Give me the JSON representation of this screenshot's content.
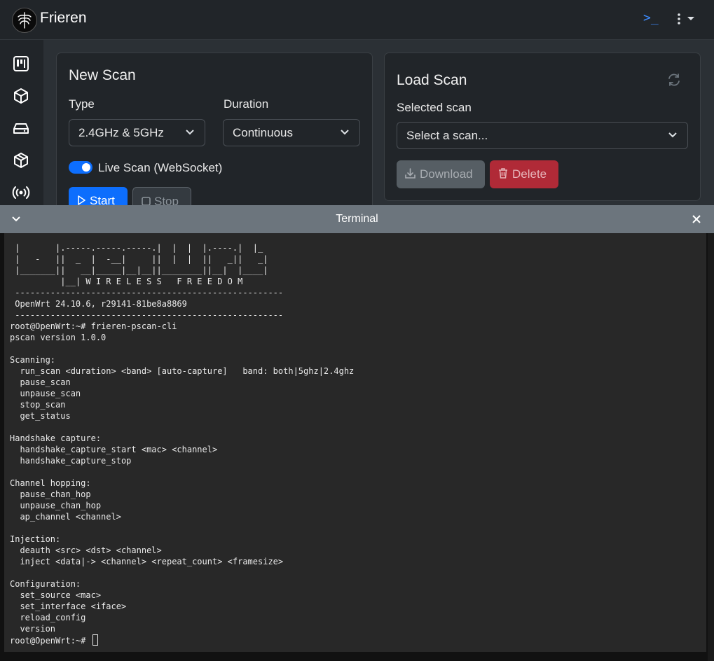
{
  "app": {
    "name": "Frieren"
  },
  "navbar": {
    "terminal_icon_label": ">_"
  },
  "sidebar": {
    "items": [
      {
        "icon": "kanban-board-icon"
      },
      {
        "icon": "box-icon"
      },
      {
        "icon": "router-drive-icon"
      },
      {
        "icon": "box-seam-icon"
      },
      {
        "icon": "broadcast-icon"
      }
    ]
  },
  "new_scan": {
    "title": "New Scan",
    "type_label": "Type",
    "type_value": "2.4GHz & 5GHz",
    "duration_label": "Duration",
    "duration_value": "Continuous",
    "live_scan_label": "Live Scan (WebSocket)",
    "live_scan_on": true,
    "start_label": "Start",
    "stop_label": "Stop"
  },
  "load_scan": {
    "title": "Load Scan",
    "selected_label": "Selected scan",
    "select_placeholder": "Select a scan...",
    "download_label": "Download",
    "delete_label": "Delete"
  },
  "terminal": {
    "title": "Terminal",
    "lines": [
      " |       |.-----.-----.-----.|  |  |  |.----.|  |_",
      " |   -   ||  _  |  -__|     ||  |  |  ||   _||   _|",
      " |_______||   __|_____|__|__||________||__|  |____|",
      "          |__| W I R E L E S S   F R E E D O M",
      " -----------------------------------------------------",
      " OpenWrt 24.10.6, r29141-81be8a8869",
      " -----------------------------------------------------",
      "root@OpenWrt:~# frieren-pscan-cli",
      "pscan version 1.0.0",
      "",
      "Scanning:",
      "  run_scan <duration> <band> [auto-capture]   band: both|5ghz|2.4ghz",
      "  pause_scan",
      "  unpause_scan",
      "  stop_scan",
      "  get_status",
      "",
      "Handshake capture:",
      "  handshake_capture_start <mac> <channel>",
      "  handshake_capture_stop",
      "",
      "Channel hopping:",
      "  pause_chan_hop",
      "  unpause_chan_hop",
      "  ap_channel <channel>",
      "",
      "Injection:",
      "  deauth <src> <dst> <channel>",
      "  inject <data|-> <channel> <repeat_count> <framesize>",
      "",
      "Configuration:",
      "  set_source <mac>",
      "  set_interface <iface>",
      "  reload_config",
      "  version"
    ],
    "prompt": "root@OpenWrt:~# "
  }
}
